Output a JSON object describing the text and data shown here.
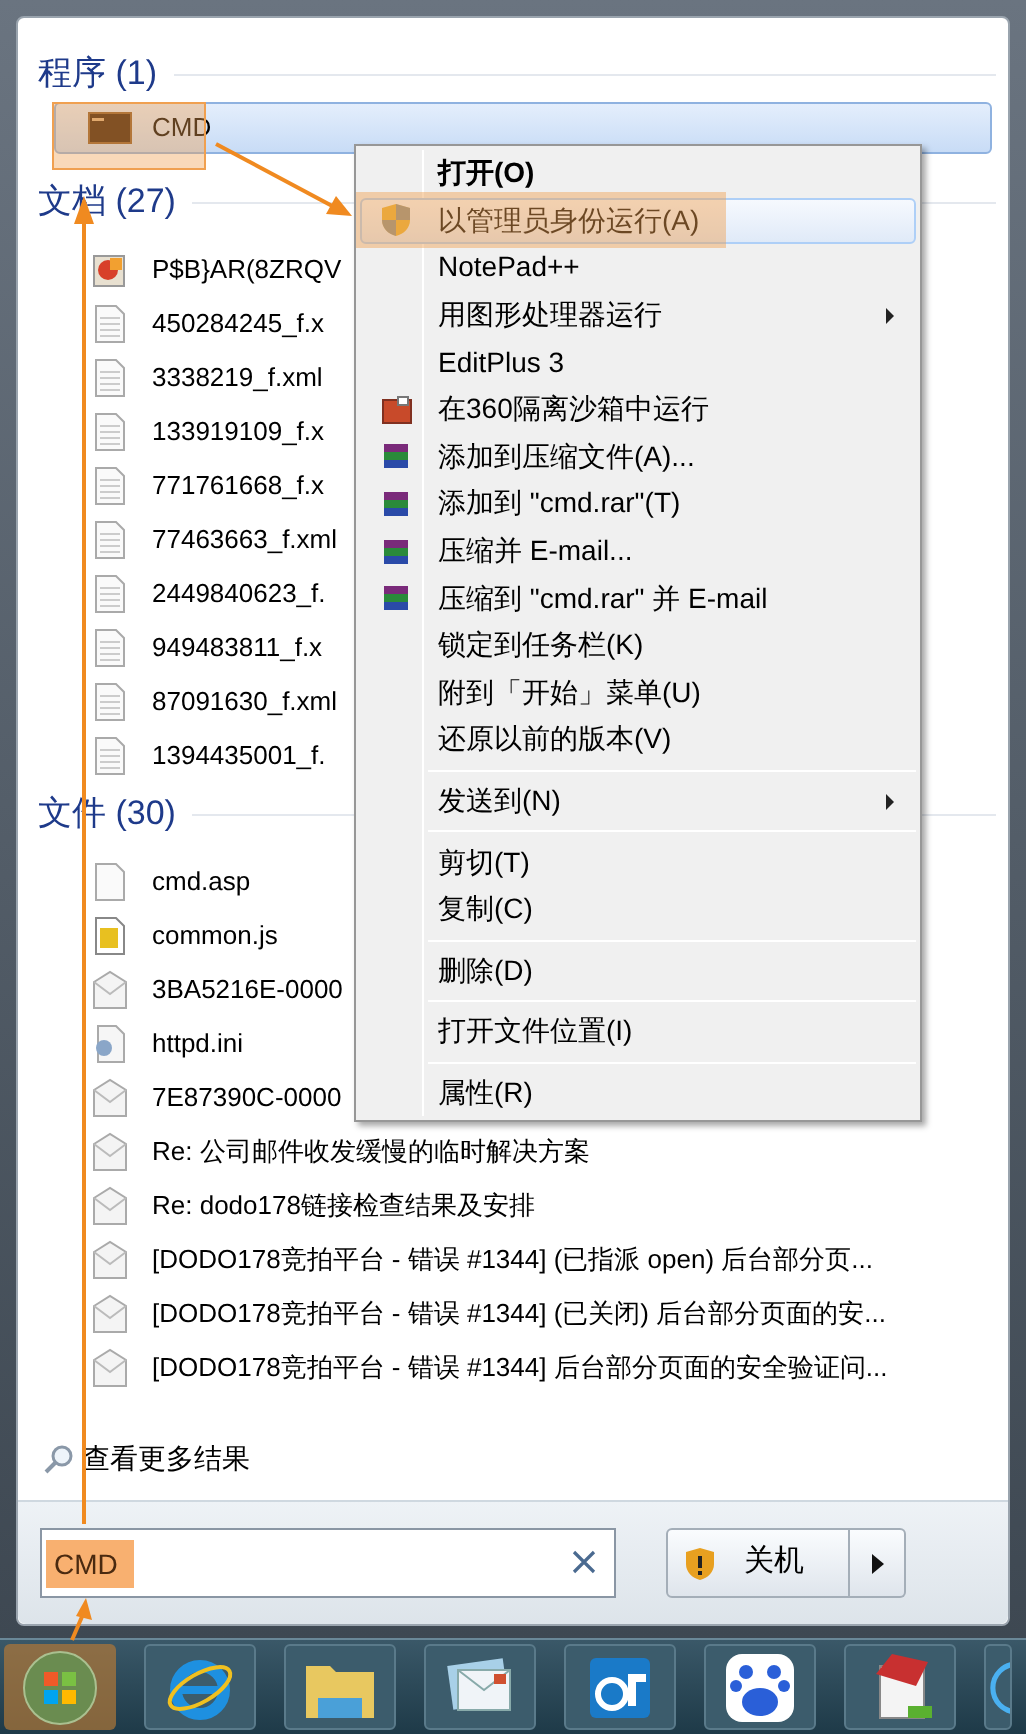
{
  "programs": {
    "title": "程序 (1)",
    "items": [
      {
        "label": "CMD",
        "kind": "console",
        "selected": true
      }
    ]
  },
  "documents": {
    "title": "文档 (27)",
    "items": [
      {
        "label": "P$B}AR(8ZRQV",
        "kind": "image"
      },
      {
        "label": "450284245_f.x",
        "kind": "doc"
      },
      {
        "label": "3338219_f.xml",
        "kind": "doc"
      },
      {
        "label": "133919109_f.x",
        "kind": "doc"
      },
      {
        "label": "771761668_f.x",
        "kind": "doc"
      },
      {
        "label": "77463663_f.xml",
        "kind": "doc"
      },
      {
        "label": "2449840623_f.",
        "kind": "doc"
      },
      {
        "label": "949483811_f.x",
        "kind": "doc"
      },
      {
        "label": "87091630_f.xml",
        "kind": "doc"
      },
      {
        "label": "1394435001_f.",
        "kind": "doc"
      }
    ]
  },
  "files": {
    "title": "文件 (30)",
    "items": [
      {
        "label": "cmd.asp",
        "kind": "blank"
      },
      {
        "label": "common.js",
        "kind": "script"
      },
      {
        "label": "3BA5216E-0000",
        "kind": "mail"
      },
      {
        "label": "httpd.ini",
        "kind": "settings"
      },
      {
        "label": "7E87390C-0000",
        "kind": "mail"
      },
      {
        "label": "Re: 公司邮件收发缓慢的临时解决方案",
        "kind": "mail"
      },
      {
        "label": "Re: dodo178链接检查结果及安排",
        "kind": "mail"
      },
      {
        "label": "[DODO178竞拍平台 - 错误 #1344] (已指派 open) 后台部分页...",
        "kind": "mail"
      },
      {
        "label": "[DODO178竞拍平台 - 错误 #1344] (已关闭) 后台部分页面的安...",
        "kind": "mail"
      },
      {
        "label": "[DODO178竞拍平台 - 错误 #1344] 后台部分页面的安全验证问...",
        "kind": "mail"
      }
    ]
  },
  "more_results": "查看更多结果",
  "search": {
    "value": "CMD"
  },
  "shutdown": {
    "label": "关机"
  },
  "context_menu": {
    "groups": [
      [
        {
          "label": "打开(O)",
          "kind": "text",
          "default": true,
          "submenu": false,
          "selected": false
        },
        {
          "label": "以管理员身份运行(A)",
          "kind": "shield",
          "default": false,
          "submenu": false,
          "selected": true
        },
        {
          "label": "NotePad++",
          "kind": "text",
          "default": false,
          "submenu": false,
          "selected": false
        },
        {
          "label": "用图形处理器运行",
          "kind": "text",
          "default": false,
          "submenu": true,
          "selected": false
        },
        {
          "label": "EditPlus 3",
          "kind": "text",
          "default": false,
          "submenu": false,
          "selected": false
        },
        {
          "label": "在360隔离沙箱中运行",
          "kind": "sandbox",
          "default": false,
          "submenu": false,
          "selected": false
        },
        {
          "label": "添加到压缩文件(A)...",
          "kind": "archive",
          "default": false,
          "submenu": false,
          "selected": false
        },
        {
          "label": "添加到 \"cmd.rar\"(T)",
          "kind": "archive",
          "default": false,
          "submenu": false,
          "selected": false
        },
        {
          "label": "压缩并 E-mail...",
          "kind": "archive",
          "default": false,
          "submenu": false,
          "selected": false
        },
        {
          "label": "压缩到 \"cmd.rar\" 并 E-mail",
          "kind": "archive",
          "default": false,
          "submenu": false,
          "selected": false
        },
        {
          "label": "锁定到任务栏(K)",
          "kind": "text",
          "default": false,
          "submenu": false,
          "selected": false
        },
        {
          "label": "附到「开始」菜单(U)",
          "kind": "text",
          "default": false,
          "submenu": false,
          "selected": false
        },
        {
          "label": "还原以前的版本(V)",
          "kind": "text",
          "default": false,
          "submenu": false,
          "selected": false
        }
      ],
      [
        {
          "label": "发送到(N)",
          "kind": "text",
          "default": false,
          "submenu": true,
          "selected": false
        }
      ],
      [
        {
          "label": "剪切(T)",
          "kind": "text",
          "default": false,
          "submenu": false,
          "selected": false
        },
        {
          "label": "复制(C)",
          "kind": "text",
          "default": false,
          "submenu": false,
          "selected": false
        }
      ],
      [
        {
          "label": "删除(D)",
          "kind": "text",
          "default": false,
          "submenu": false,
          "selected": false
        }
      ],
      [
        {
          "label": "打开文件位置(I)",
          "kind": "text",
          "default": false,
          "submenu": false,
          "selected": false
        }
      ],
      [
        {
          "label": "属性(R)",
          "kind": "text",
          "default": false,
          "submenu": false,
          "selected": false
        }
      ]
    ]
  },
  "taskbar": [
    {
      "kind": "start",
      "selected": true
    },
    {
      "kind": "browser",
      "selected": false
    },
    {
      "kind": "folder",
      "selected": false
    },
    {
      "kind": "mail",
      "selected": false
    },
    {
      "kind": "app",
      "selected": false
    },
    {
      "kind": "paw",
      "selected": false
    },
    {
      "kind": "notepad",
      "selected": false
    },
    {
      "kind": "globe",
      "selected": false
    }
  ]
}
